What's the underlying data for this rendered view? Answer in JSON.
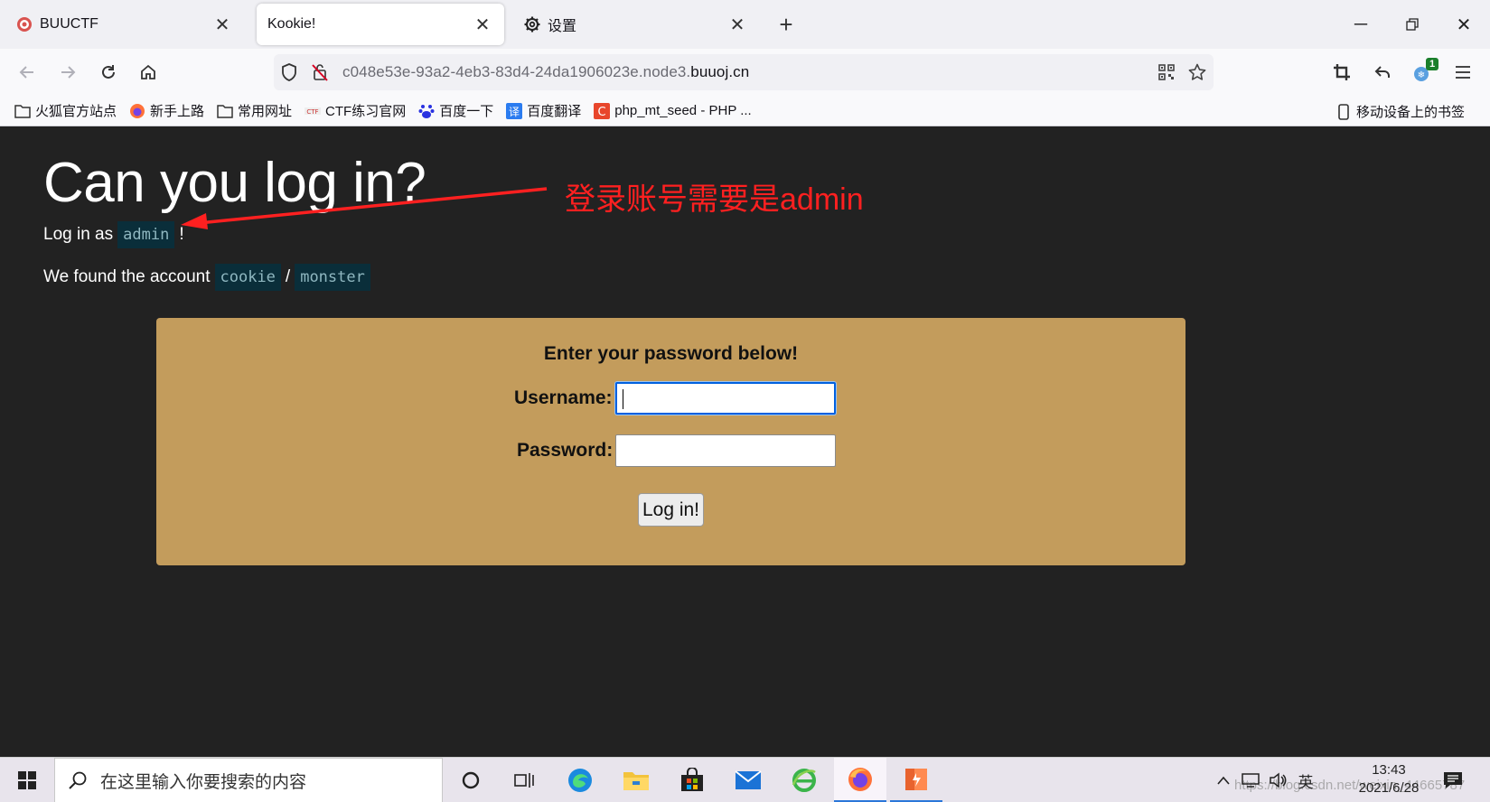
{
  "browser": {
    "tabs": [
      {
        "title": "BUUCTF",
        "active": false
      },
      {
        "title": "Kookie!",
        "active": true
      },
      {
        "title": "设置",
        "active": false
      }
    ],
    "url_prefix": "c048e53e-93a2-4eb3-83d4-24da1906023e.node3.",
    "url_domain": "buuoj.cn",
    "extension_badge": "1",
    "bookmarks": [
      "火狐官方站点",
      "新手上路",
      "常用网址",
      "CTF练习官网",
      "百度一下",
      "百度翻译",
      "php_mt_seed - PHP ..."
    ],
    "mobile_bookmarks": "移动设备上的书签"
  },
  "page": {
    "title": "Can you log in?",
    "login_prefix": "Log in as",
    "login_user": "admin",
    "login_suffix": "!",
    "account_prefix": "We found the account",
    "account_user": "cookie",
    "account_sep": "/",
    "account_pass": "monster",
    "annotation": "登录账号需要是admin",
    "form": {
      "heading": "Enter your password below!",
      "username_label": "Username:",
      "username_value": "",
      "password_label": "Password:",
      "password_value": "",
      "submit_label": "Log in!"
    }
  },
  "taskbar": {
    "search_placeholder": "在这里输入你要搜索的内容",
    "ime": "英",
    "time": "13:43",
    "date": "2021/6/28",
    "watermark": "https://blog.csdn.net/weixin_44665787"
  },
  "colors": {
    "page_bg": "#222222",
    "panel_bg": "#c39c5c",
    "code_bg": "#0a2e3a",
    "annotation": "#ff2020"
  }
}
